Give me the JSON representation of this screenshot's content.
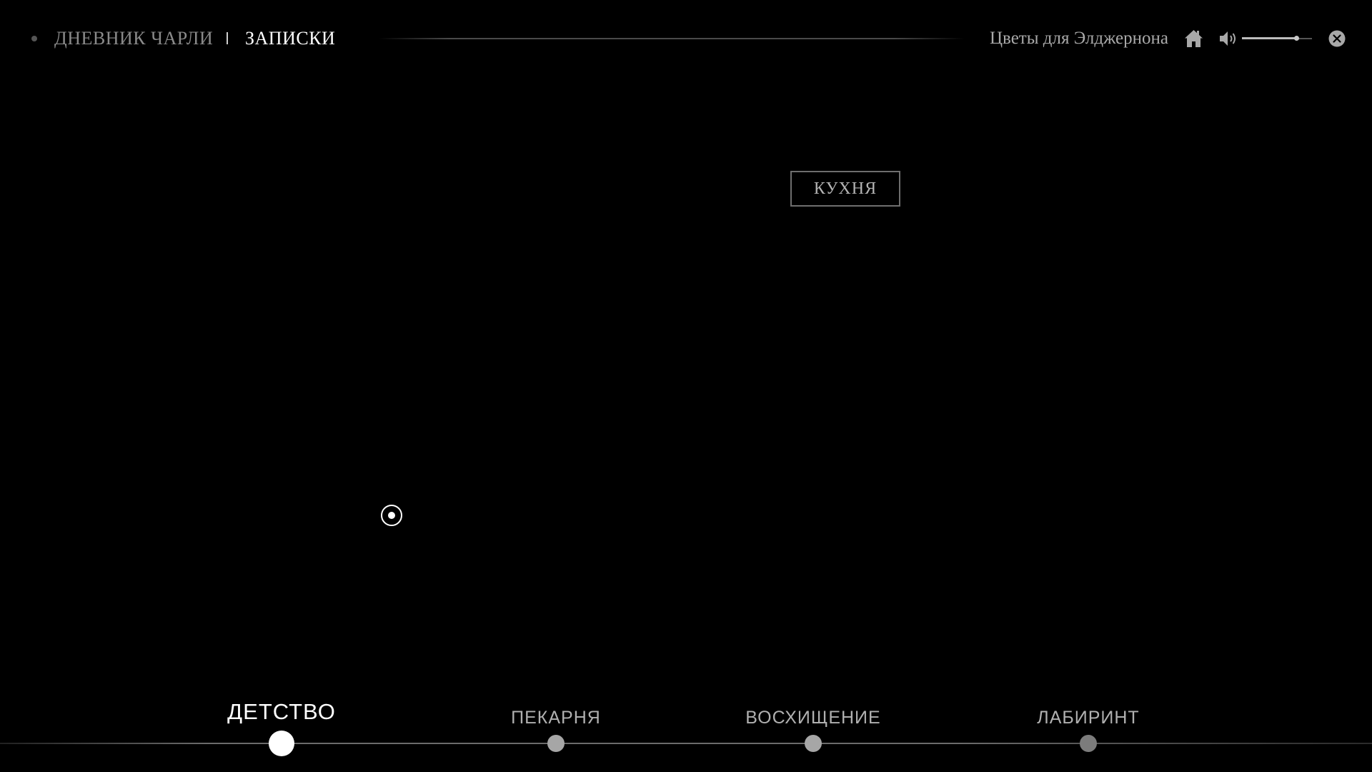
{
  "breadcrumb": {
    "diary": "ДНЕВНИК ЧАРЛИ",
    "notes": "ЗАПИСКИ"
  },
  "header": {
    "game_title": "Цветы для Элджернона",
    "icons": [
      "home-icon",
      "volume-icon",
      "close-icon"
    ],
    "volume_level": 0.78
  },
  "scene": {
    "location_label": "КУХНЯ"
  },
  "timeline": {
    "chapters": [
      {
        "label": "ДЕТСТВО",
        "active": true
      },
      {
        "label": "ПЕКАРНЯ",
        "active": false
      },
      {
        "label": "ВОСХИЩЕНИЕ",
        "active": false
      },
      {
        "label": "ЛАБИРИНТ",
        "active": false
      }
    ]
  },
  "colors": {
    "background": "#000000",
    "muted_text": "#8a8a8a",
    "active_text": "#ffffff"
  }
}
